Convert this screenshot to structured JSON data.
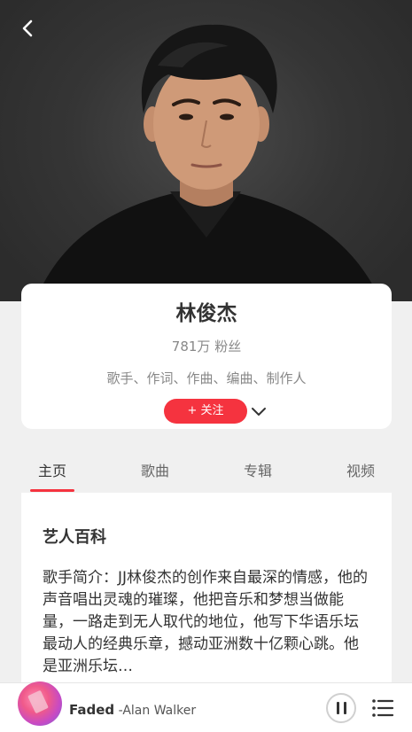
{
  "colors": {
    "accent": "#f5333f",
    "background": "#f0f0f0",
    "card": "#ffffff"
  },
  "header": {
    "back_icon": "chevron-left-icon"
  },
  "artist": {
    "name": "林俊杰",
    "fans": "781万 粉丝",
    "roles": "歌手、作词、作曲、编曲、制作人",
    "follow_label": "+ 关注",
    "expand_icon": "chevron-down-icon"
  },
  "tabs": [
    {
      "label": "主页",
      "active": true
    },
    {
      "label": "歌曲",
      "active": false
    },
    {
      "label": "专辑",
      "active": false
    },
    {
      "label": "视频",
      "active": false
    }
  ],
  "wiki": {
    "title": "艺人百科",
    "text": "歌手简介：JJ林俊杰的创作来自最深的情感，他的声音唱出灵魂的璀璨，他把音乐和梦想当做能量，一路走到无人取代的地位，他写下华语乐坛最动人的经典乐章，撼动亚洲数十亿颗心跳。他是亚洲乐坛…"
  },
  "player": {
    "song_title": "Faded",
    "artist": " -Alan Walker",
    "pause_icon": "pause-icon",
    "playlist_icon": "playlist-icon"
  }
}
